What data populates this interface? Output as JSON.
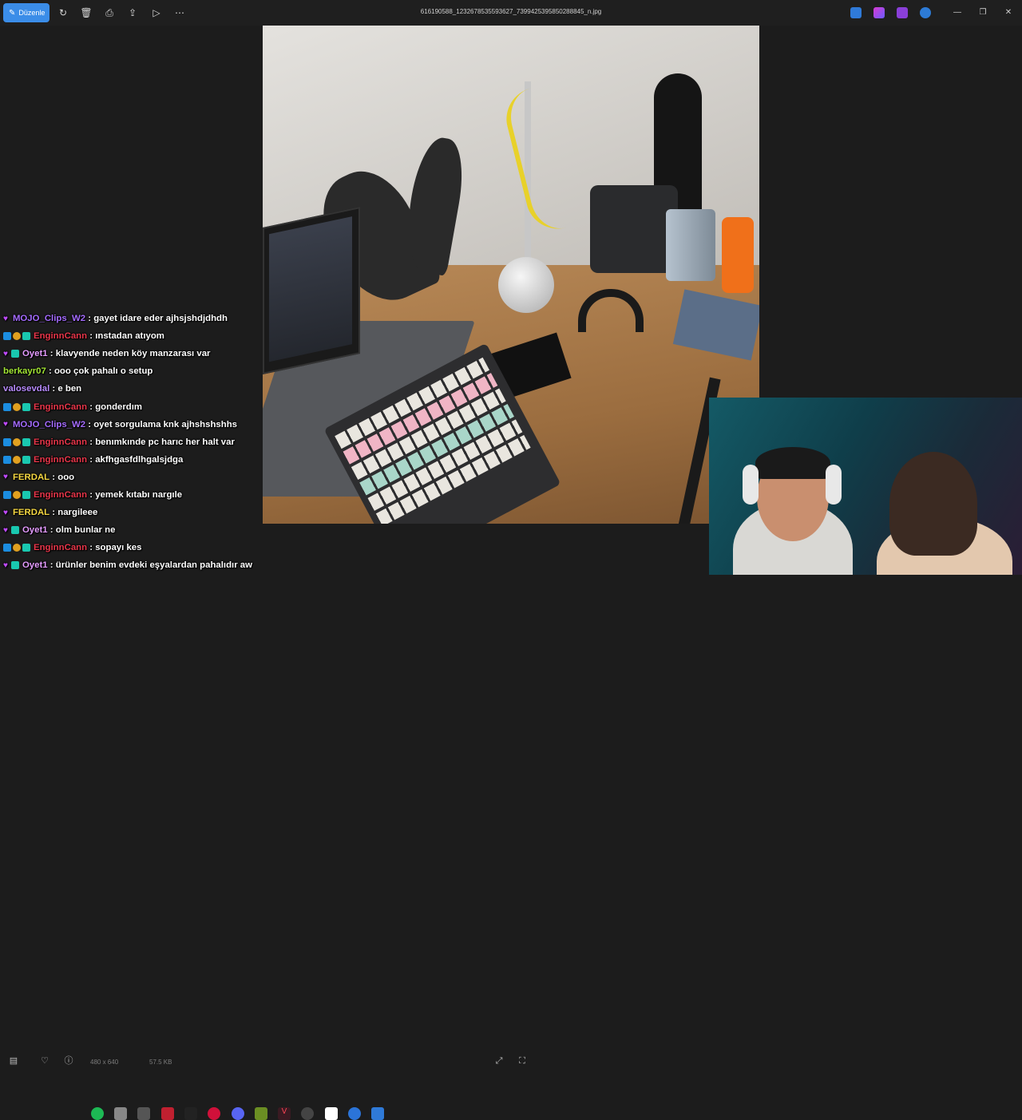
{
  "titlebar": {
    "edit_label": "Düzenle",
    "filename": "616190588_1232678535593627_7399425395850288845_n.jpg",
    "icons": [
      "rotate-icon",
      "delete-icon",
      "print-icon",
      "share-icon",
      "slideshow-icon",
      "more-icon"
    ],
    "window_controls": [
      "minimize-icon",
      "restore-icon",
      "close-icon"
    ]
  },
  "viewer": {
    "dimensions": "480 x 640",
    "filesize": "57.5 KB"
  },
  "chat": {
    "messages": [
      {
        "user": "MOJO_Clips_W2",
        "user_color": "#a56cff",
        "badges": [
          "heart"
        ],
        "text": ": gayet idare eder ajhsjshdjdhdh"
      },
      {
        "user": "EnginnCann",
        "user_color": "#e8364a",
        "badges": [
          "blue",
          "gold",
          "teal"
        ],
        "text": ": ınstadan atıyom"
      },
      {
        "user": "Oyet1",
        "user_color": "#e59cff",
        "badges": [
          "heart",
          "teal"
        ],
        "text": ": klavyende neden köy manzarası var"
      },
      {
        "user": "berkayr07",
        "user_color": "#a3e635",
        "badges": [],
        "text": ": ooo çok pahalı o setup"
      },
      {
        "user": "valosevdal",
        "user_color": "#b98cff",
        "badges": [],
        "text": ": e ben"
      },
      {
        "user": "EnginnCann",
        "user_color": "#e8364a",
        "badges": [
          "blue",
          "gold",
          "teal"
        ],
        "text": ": gonderdım"
      },
      {
        "user": "MOJO_Clips_W2",
        "user_color": "#a56cff",
        "badges": [
          "heart"
        ],
        "text": ": oyet sorgulama knk ajhshshshhs"
      },
      {
        "user": "EnginnCann",
        "user_color": "#e8364a",
        "badges": [
          "blue",
          "gold",
          "teal"
        ],
        "text": ": benımkınde pc harıc her halt var"
      },
      {
        "user": "EnginnCann",
        "user_color": "#e8364a",
        "badges": [
          "blue",
          "gold",
          "teal"
        ],
        "text": ": akfhgasfdlhgalsjdga"
      },
      {
        "user": "FERDAL",
        "user_color": "#f5d742",
        "badges": [
          "heart"
        ],
        "text": ": ooo"
      },
      {
        "user": "EnginnCann",
        "user_color": "#e8364a",
        "badges": [
          "blue",
          "gold",
          "teal"
        ],
        "text": ": yemek kıtabı nargıle"
      },
      {
        "user": "FERDAL",
        "user_color": "#f5d742",
        "badges": [
          "heart"
        ],
        "text": ": nargileee"
      },
      {
        "user": "Oyet1",
        "user_color": "#e59cff",
        "badges": [
          "heart",
          "teal"
        ],
        "text": ": olm bunlar ne"
      },
      {
        "user": "EnginnCann",
        "user_color": "#e8364a",
        "badges": [
          "blue",
          "gold",
          "teal"
        ],
        "text": ": sopayı kes"
      },
      {
        "user": "Oyet1",
        "user_color": "#e59cff",
        "badges": [
          "heart",
          "teal"
        ],
        "text": ": ürünler benim evdeki eşyalardan pahalıdır aw"
      }
    ]
  },
  "colors": {
    "accent": "#3b8de8",
    "titlebar_bg": "#1f1f1f",
    "background": "#1c1c1c"
  }
}
